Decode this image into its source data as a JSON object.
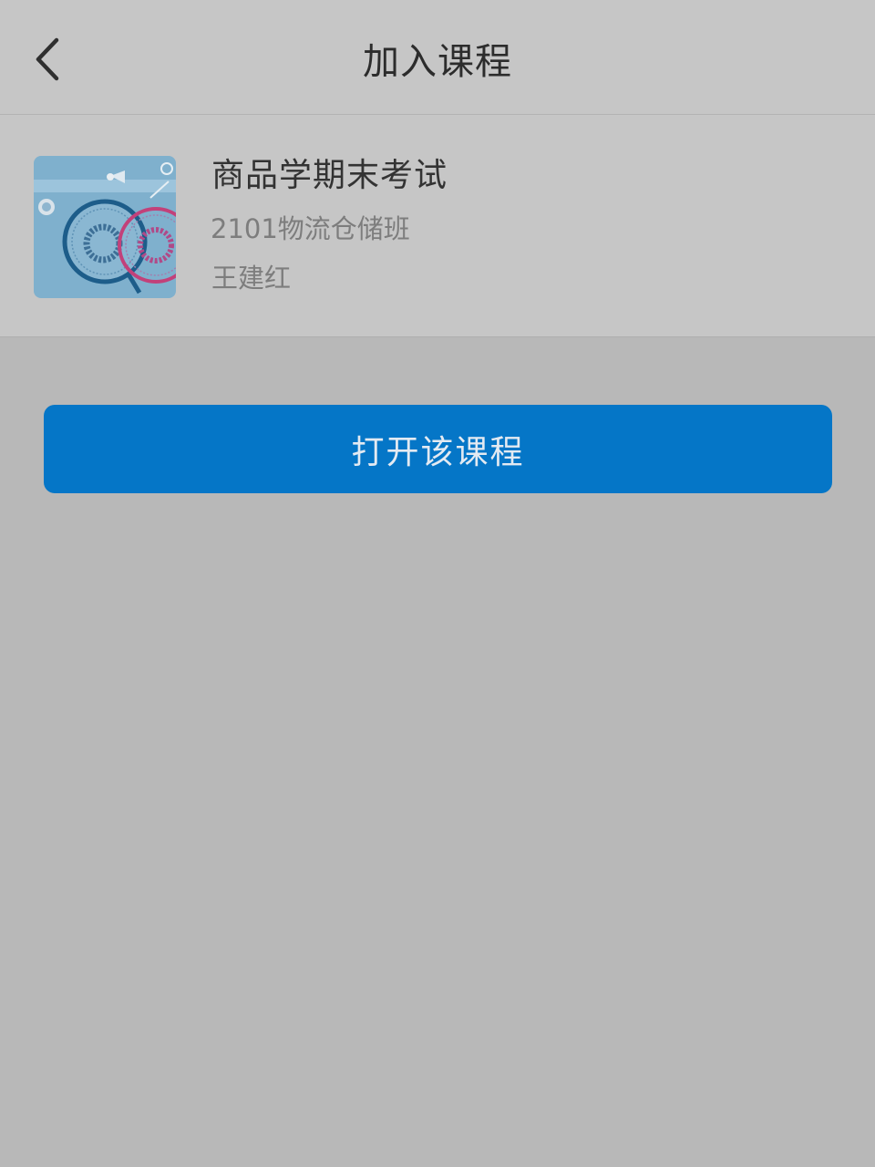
{
  "header": {
    "title": "加入课程",
    "back_icon": "chevron-left-icon"
  },
  "course": {
    "title": "商品学期末考试",
    "class_name": "2101物流仓储班",
    "teacher": "王建红",
    "thumbnail_icon": "badminton-rackets-image"
  },
  "actions": {
    "open_label": "打开该课程"
  },
  "colors": {
    "page_background": "#b8b8b8",
    "panel_background": "#c6c6c6",
    "primary_button": "#0576c7",
    "thumbnail_background": "#7fb0cd"
  }
}
